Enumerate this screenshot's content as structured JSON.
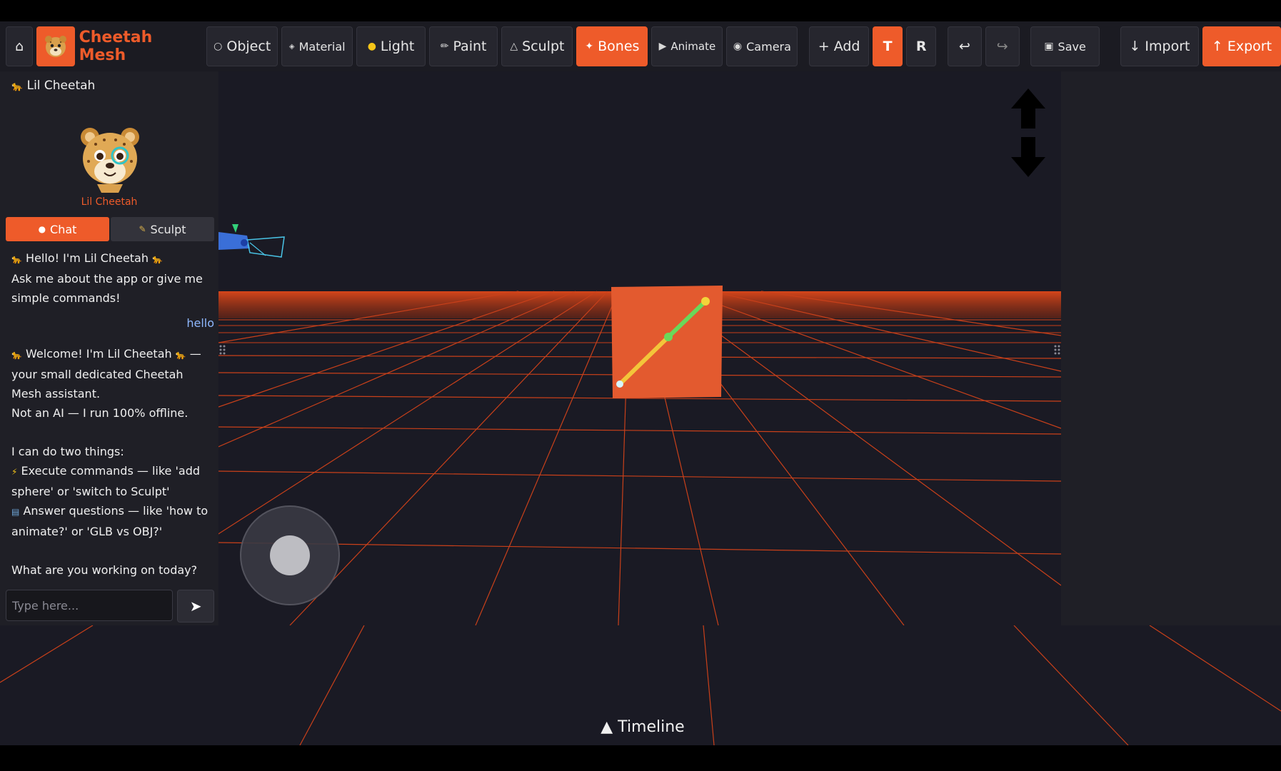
{
  "toolbar": {
    "home_glyph": "⌂",
    "brand": "Cheetah Mesh",
    "object": "Object",
    "material": "Material",
    "light": "Light",
    "paint": "Paint",
    "sculpt": "Sculpt",
    "bones": "Bones",
    "animate": "Animate",
    "camera": "Camera",
    "add": "+ Add",
    "translate": "T",
    "rotate": "R",
    "undo_glyph": "↩",
    "redo_glyph": "↪",
    "save": "Save",
    "import": "↓ Import",
    "export": "↑ Export"
  },
  "sidebar": {
    "header": "Lil Cheetah",
    "avatar_name": "Lil Cheetah",
    "tabs": {
      "chat": "Chat",
      "sculpt": "Sculpt"
    },
    "messages": {
      "greeting_l1": "Hello! I'm Lil Cheetah",
      "greeting_l2": "Ask me about the app or give me simple commands!",
      "user_msg": "hello",
      "welcome_l1": "Welcome! I'm Lil Cheetah",
      "welcome_l1b": "— your small dedicated Cheetah Mesh assistant.",
      "welcome_l2": "Not an AI — I run 100% offline.",
      "welcome_l3": "I can do two things:",
      "welcome_l4": "Execute commands — like 'add sphere' or 'switch to Sculpt'",
      "welcome_l5": "Answer questions — like 'how to animate?' or 'GLB vs OBJ?'",
      "welcome_l6": "What are you working on today?"
    },
    "input_placeholder": "Type here...",
    "send_glyph": "➤"
  },
  "viewport": {
    "timeline": "▲ Timeline"
  },
  "colors": {
    "accent": "#ee5b2a",
    "grid": "#d2431a",
    "background": "#1a1a24"
  }
}
